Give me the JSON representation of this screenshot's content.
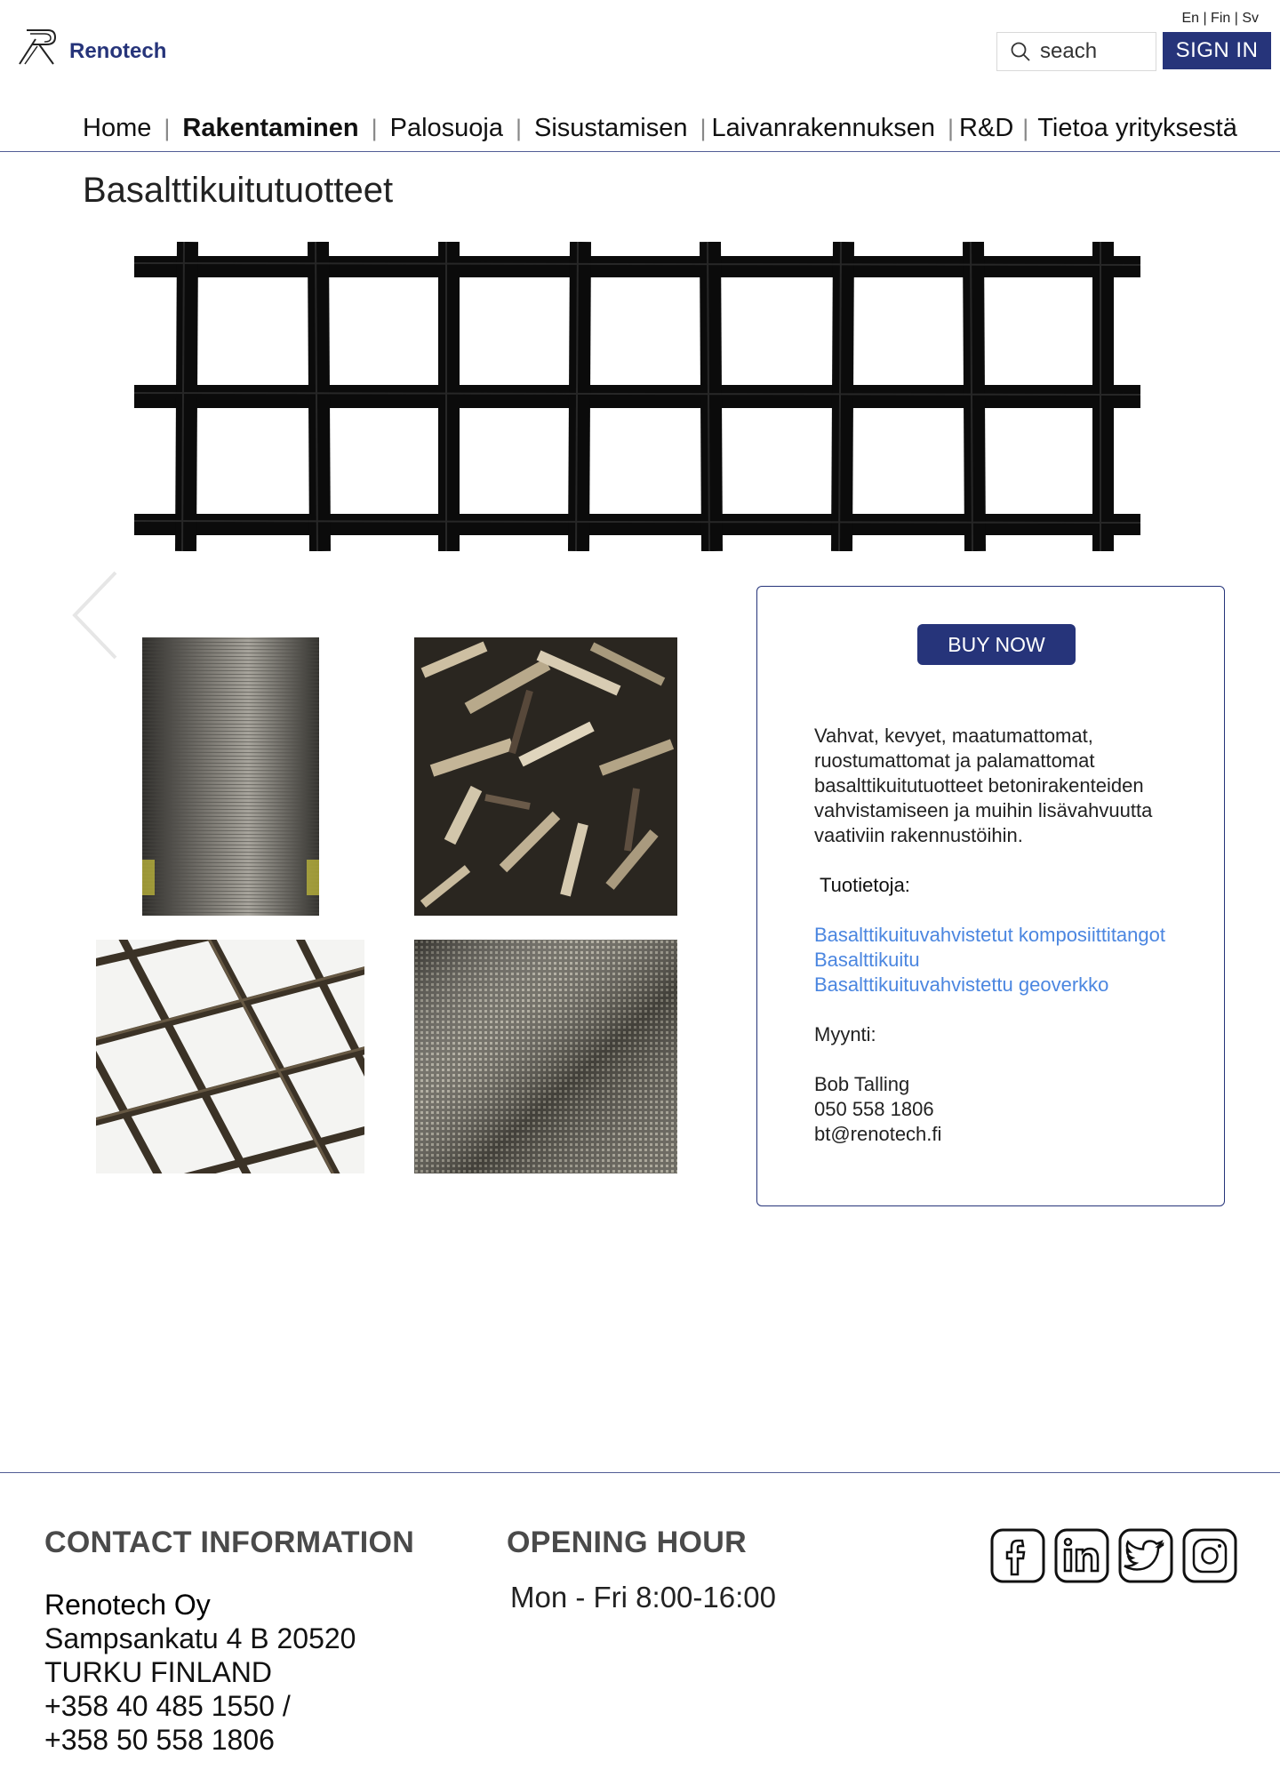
{
  "brand": {
    "name": "Renotech",
    "logo_icon": "renotech-r-logo-icon"
  },
  "header": {
    "languages": "En | Fin | Sv",
    "search": {
      "placeholder": "seach",
      "icon": "search-icon"
    },
    "signin_label": "SIGN IN"
  },
  "nav": {
    "items": [
      {
        "label": "Home"
      },
      {
        "label": "Rakentaminen",
        "active": true
      },
      {
        "label": "Palosuoja"
      },
      {
        "label": "Sisustamisen"
      },
      {
        "label": "Laivanrakennuksen"
      },
      {
        "label": "R&D"
      },
      {
        "label": "Tietoa yrityksestä"
      }
    ]
  },
  "page": {
    "title": "Basalttikuitutuotteet"
  },
  "card": {
    "buy_label": "BUY NOW",
    "description_lines": [
      "Vahvat, kevyet, maatumattomat,",
      "ruostumattomat ja palamattomat",
      "basalttikuitutuotteet betonirakenteiden",
      "vahvistamiseen ja muihin lisävahvuutta",
      "vaativiin rakennustöihin."
    ],
    "product_info_label": "Tuotietoja:",
    "links": [
      "Basalttikuituvahvistetut komposiittitangot",
      "Basalttikuitu",
      "Basalttikuituvahvistettu geoverkko"
    ],
    "sales_label": "Myynti:",
    "sales_contact": [
      "Bob Talling",
      "050 558 1806",
      "bt@renotech.fi"
    ]
  },
  "footer": {
    "contact_heading": "CONTACT INFORMATION",
    "contact_lines": [
      "Renotech Oy",
      "Sampsankatu 4 B 20520",
      "TURKU FINLAND",
      "+358 40 485 1550 /",
      "+358 50 558 1806"
    ],
    "hours_heading": "OPENING HOUR",
    "hours": "Mon - Fri  8:00-16:00",
    "social_icons": [
      "facebook-icon",
      "linkedin-icon",
      "twitter-icon",
      "instagram-icon"
    ]
  },
  "colors": {
    "brand_navy": "#26347a",
    "link_blue": "#4b86e0",
    "heading_gray": "#4a4a4a"
  }
}
